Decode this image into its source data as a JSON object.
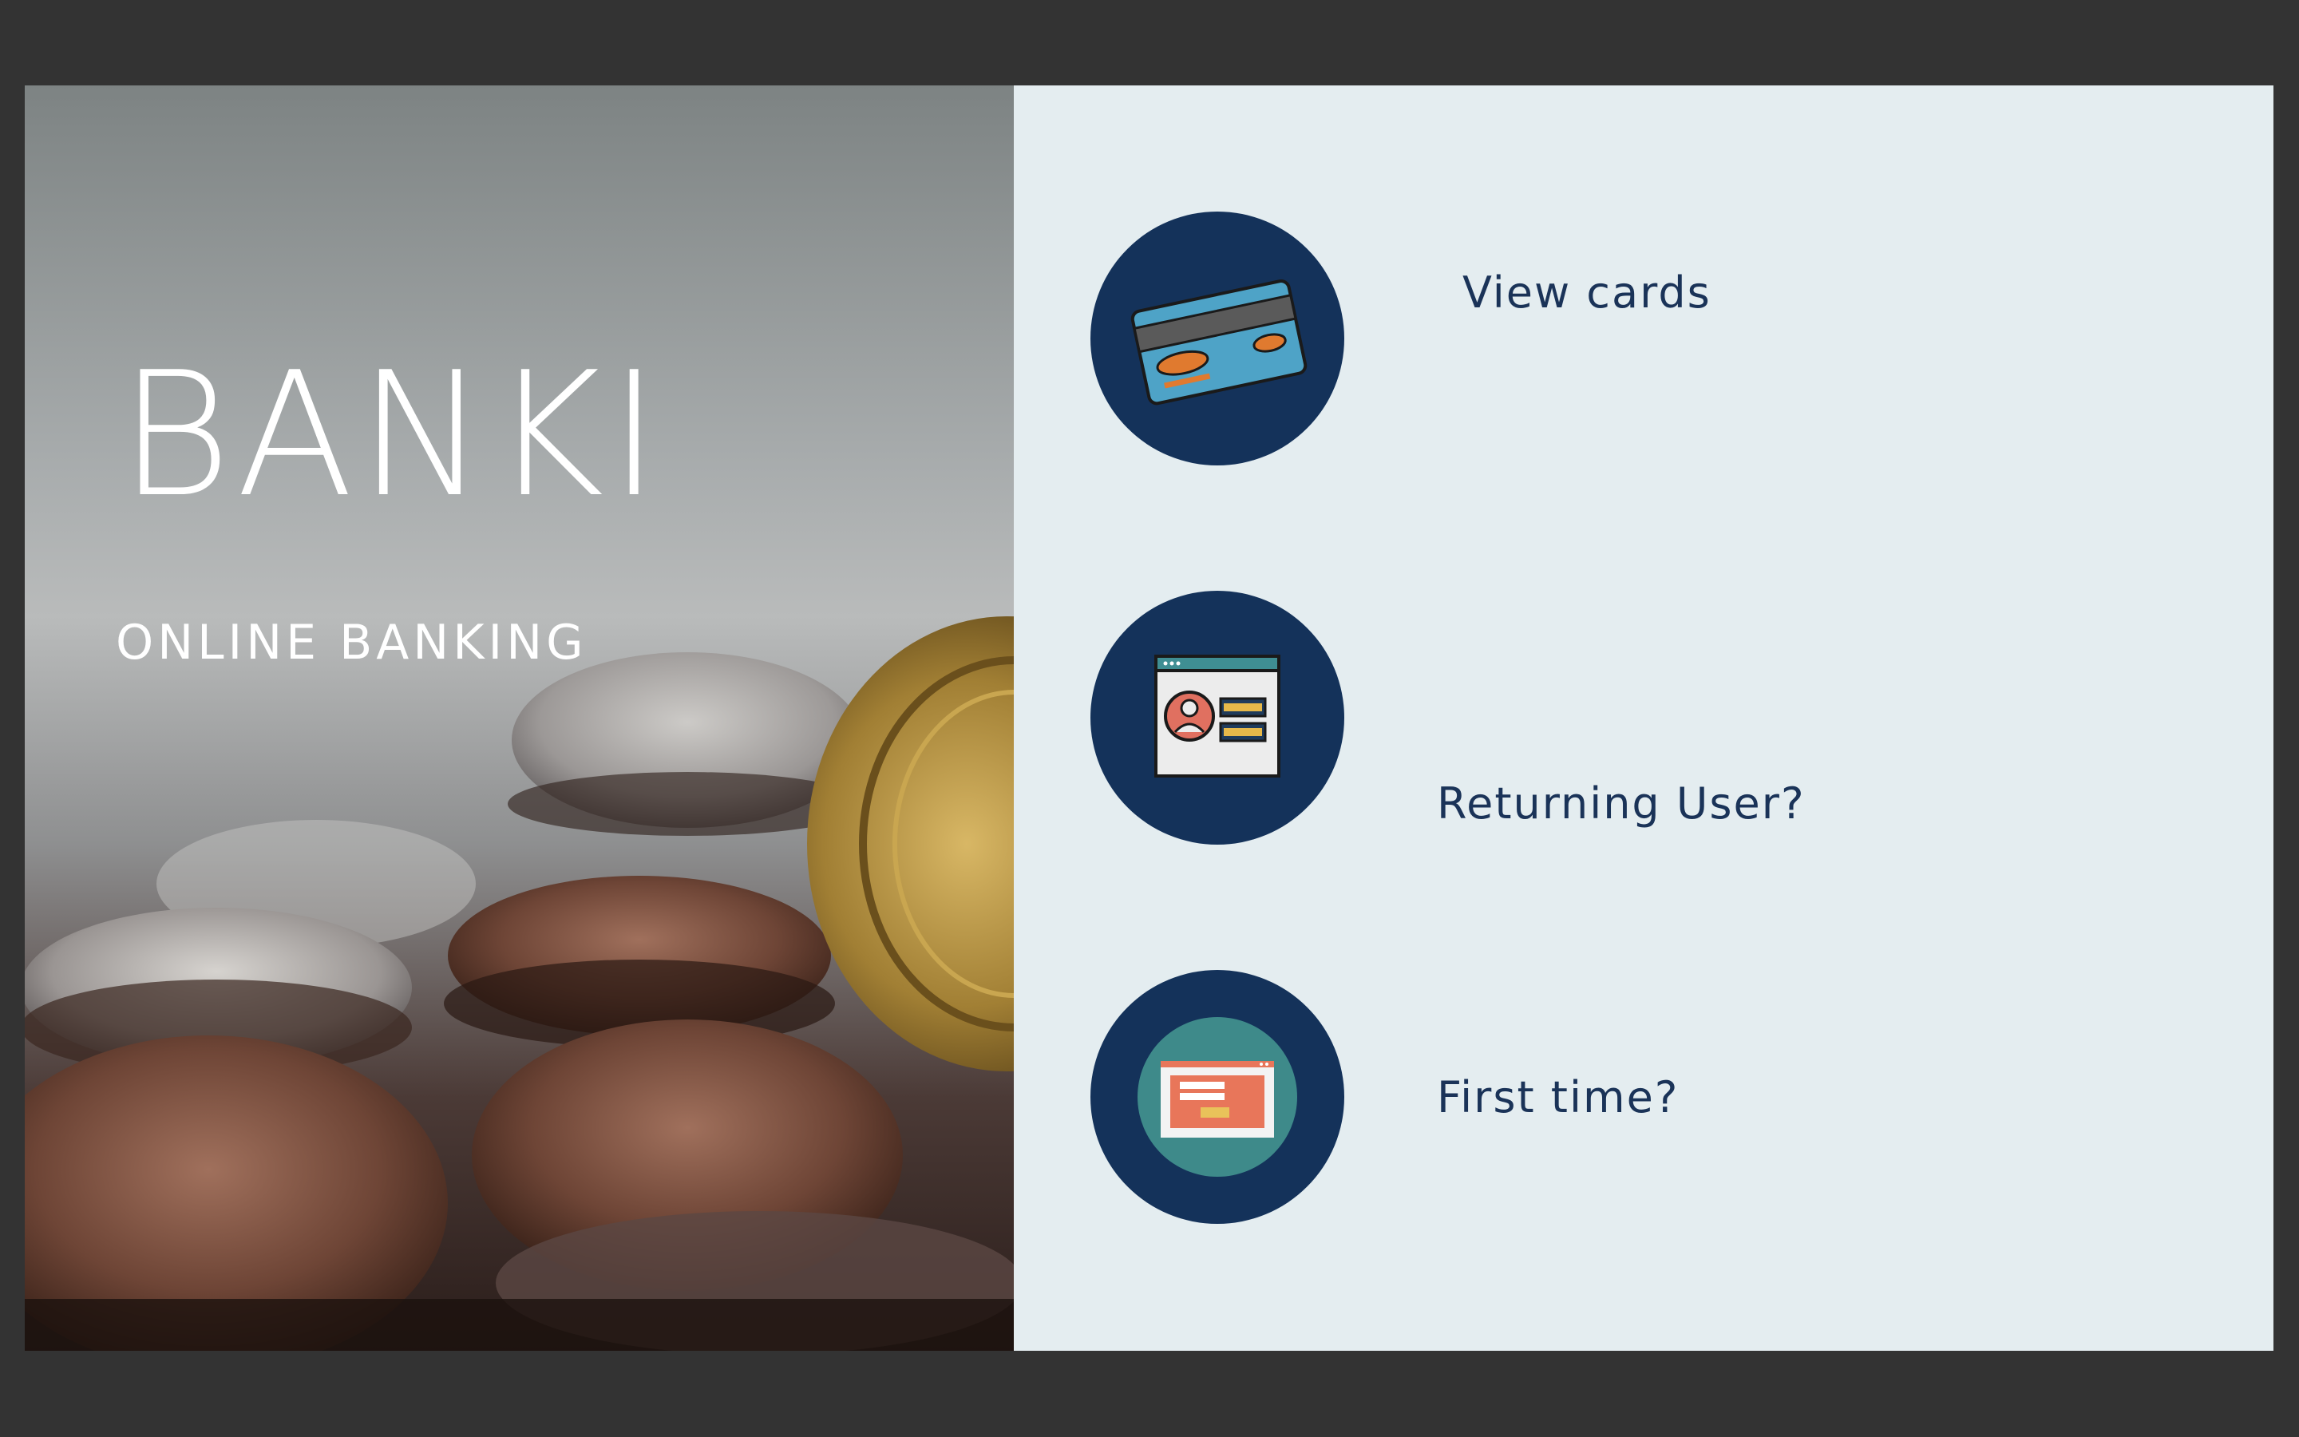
{
  "brand": {
    "title": "BANKI",
    "subtitle": "ONLINE BANKING"
  },
  "options": [
    {
      "label": "View cards",
      "icon": "credit-card-icon"
    },
    {
      "label": "Returning User?",
      "icon": "user-profile-window-icon"
    },
    {
      "label": "First time?",
      "icon": "login-form-window-icon"
    }
  ],
  "colors": {
    "background": "#333333",
    "panel": "#e4edf0",
    "circle": "#14325a",
    "label": "#1a3358",
    "accent_orange": "#e8765a",
    "accent_teal": "#3e8a8a"
  }
}
